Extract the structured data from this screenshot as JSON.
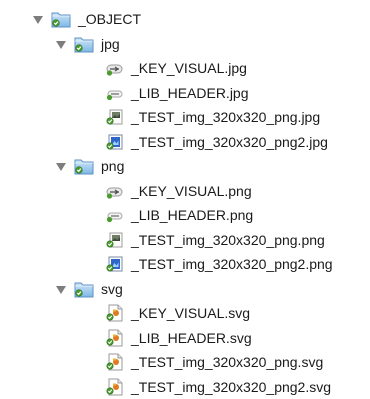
{
  "root": {
    "name": "_OBJECT",
    "icon": "folder-icon",
    "expanded": true,
    "folders": [
      {
        "name": "jpg",
        "icon": "folder-icon",
        "expanded": true,
        "files": [
          {
            "name": "_KEY_VISUAL.jpg",
            "icon": "alias-file-icon"
          },
          {
            "name": "_LIB_HEADER.jpg",
            "icon": "alias-file-icon"
          },
          {
            "name": "_TEST_img_320x320_png.jpg",
            "icon": "image-file-icon"
          },
          {
            "name": "_TEST_img_320x320_png2.jpg",
            "icon": "image-blue-file-icon"
          }
        ]
      },
      {
        "name": "png",
        "icon": "folder-icon",
        "expanded": true,
        "files": [
          {
            "name": "_KEY_VISUAL.png",
            "icon": "alias-file-icon"
          },
          {
            "name": "_LIB_HEADER.png",
            "icon": "alias-file-icon"
          },
          {
            "name": "_TEST_img_320x320_png.png",
            "icon": "image-file-icon"
          },
          {
            "name": "_TEST_img_320x320_png2.png",
            "icon": "image-blue-file-icon"
          }
        ]
      },
      {
        "name": "svg",
        "icon": "folder-icon",
        "expanded": true,
        "files": [
          {
            "name": "_KEY_VISUAL.svg",
            "icon": "svg-file-icon"
          },
          {
            "name": "_LIB_HEADER.svg",
            "icon": "svg-file-icon"
          },
          {
            "name": "_TEST_img_320x320_png.svg",
            "icon": "svg-file-icon"
          },
          {
            "name": "_TEST_img_320x320_png2.svg",
            "icon": "svg-file-icon"
          }
        ]
      }
    ]
  }
}
